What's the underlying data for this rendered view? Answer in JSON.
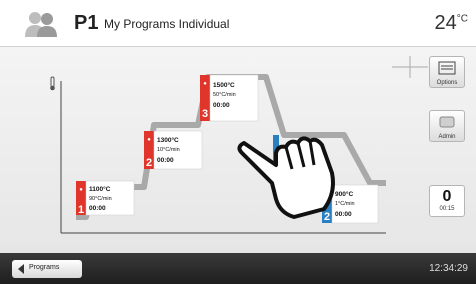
{
  "header": {
    "program_id": "P1",
    "program_name": "My Programs Individual",
    "temperature_unit": "24",
    "temperature_sup": "°C"
  },
  "steps": [
    {
      "num": "1",
      "temp": "1100°C",
      "rate": "90°C/min",
      "hold": "00:00",
      "color": "#e0352b"
    },
    {
      "num": "2",
      "temp": "1300°C",
      "rate": "10°C/min",
      "hold": "00:00",
      "color": "#e0352b"
    },
    {
      "num": "3",
      "temp": "1500°C",
      "rate": "50°C/min",
      "hold": "00:00",
      "color": "#e0352b"
    },
    {
      "num": "2",
      "temp": "900°C",
      "rate": "1°C/min",
      "hold": "00:00",
      "color": "#2a7fc1"
    }
  ],
  "side": {
    "options_label": "Options",
    "admin_label": "Admin",
    "counter_value": "0",
    "counter_time": "00:15"
  },
  "footer": {
    "back_label": "Programs",
    "clock": "12:34:29"
  },
  "colors": {
    "heating": "#e0352b",
    "cooling": "#2a7fc1",
    "curve": "#a9a9a9"
  }
}
